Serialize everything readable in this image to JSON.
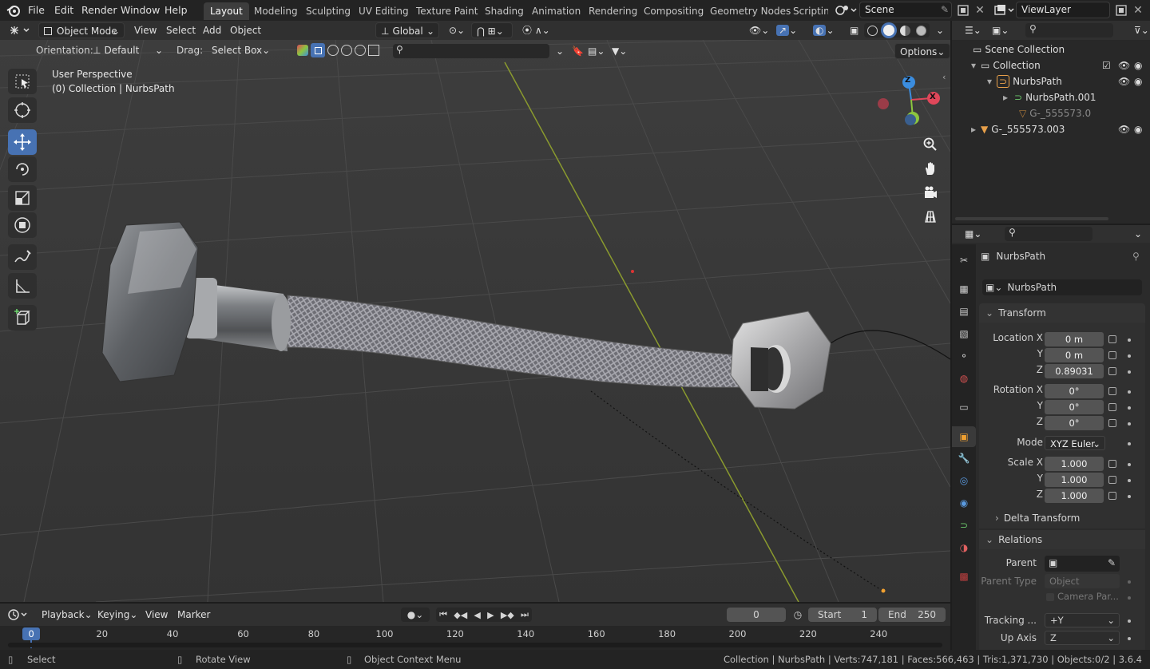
{
  "menubar": {
    "items": [
      "File",
      "Edit",
      "Render",
      "Window",
      "Help"
    ],
    "workspaces": [
      "Layout",
      "Modeling",
      "Sculpting",
      "UV Editing",
      "Texture Paint",
      "Shading",
      "Animation",
      "Rendering",
      "Compositing",
      "Geometry Nodes",
      "Scripting"
    ],
    "active_workspace": "Layout",
    "scene": "Scene",
    "view_layer": "ViewLayer"
  },
  "viewport_header": {
    "mode": "Object Mode",
    "menus": [
      "View",
      "Select",
      "Add",
      "Object"
    ],
    "transform_orientation": "Global",
    "orientation_label": "Orientation:",
    "orientation_value": "Default",
    "drag_label": "Drag:",
    "drag_value": "Select Box",
    "options": "Options"
  },
  "viewport": {
    "perspective": "User Perspective",
    "context": "(0) Collection | NurbsPath",
    "gizmo_axes": [
      "Z",
      "X",
      "Y"
    ]
  },
  "outliner": {
    "rows": [
      {
        "label": "Scene Collection",
        "indent": 0
      },
      {
        "label": "Collection",
        "indent": 1
      },
      {
        "label": "NurbsPath",
        "indent": 2
      },
      {
        "label": "NurbsPath.001",
        "indent": 3
      },
      {
        "label": "G-_555573.0",
        "indent": 3
      },
      {
        "label": "G-_555573.003",
        "indent": 1
      }
    ]
  },
  "properties": {
    "object_name": "NurbsPath",
    "data_name": "NurbsPath",
    "transform_title": "Transform",
    "location": {
      "label": "Location X",
      "x": "0 m",
      "y": "0 m",
      "z": "0.89031"
    },
    "rotation": {
      "label": "Rotation X",
      "x": "0°",
      "y": "0°",
      "z": "0°"
    },
    "mode_label": "Mode",
    "mode_value": "XYZ Euler",
    "scale": {
      "label": "Scale X",
      "x": "1.000",
      "y": "1.000",
      "z": "1.000"
    },
    "axis_y": "Y",
    "axis_z": "Z",
    "delta_transform": "Delta Transform",
    "relations_title": "Relations",
    "parent_label": "Parent",
    "parent_type_label": "Parent Type",
    "parent_type_value": "Object",
    "camera_parent": "Camera Par...",
    "tracking_label": "Tracking ...",
    "tracking_value": "+Y",
    "up_axis_label": "Up Axis",
    "up_axis_value": "Z"
  },
  "timeline": {
    "menus": [
      "Playback",
      "Keying",
      "View",
      "Marker"
    ],
    "current_frame": "0",
    "start_label": "Start",
    "start": "1",
    "end_label": "End",
    "end": "250",
    "ruler": [
      "0",
      "20",
      "40",
      "60",
      "80",
      "100",
      "120",
      "140",
      "160",
      "180",
      "200",
      "220",
      "240"
    ]
  },
  "statusbar": {
    "select": "Select",
    "rotate": "Rotate View",
    "context_menu": "Object Context Menu",
    "stats": "Collection | NurbsPath | Verts:747,181 | Faces:566,463 | Tris:1,371,730 | Objects:0/2 | 3.6.4"
  },
  "colors": {
    "accent": "#4772b3",
    "x_axis": "#e0475a",
    "y_axis": "#8cc63f",
    "z_axis": "#3b8ddf",
    "y_line": "#8a9a2e"
  }
}
